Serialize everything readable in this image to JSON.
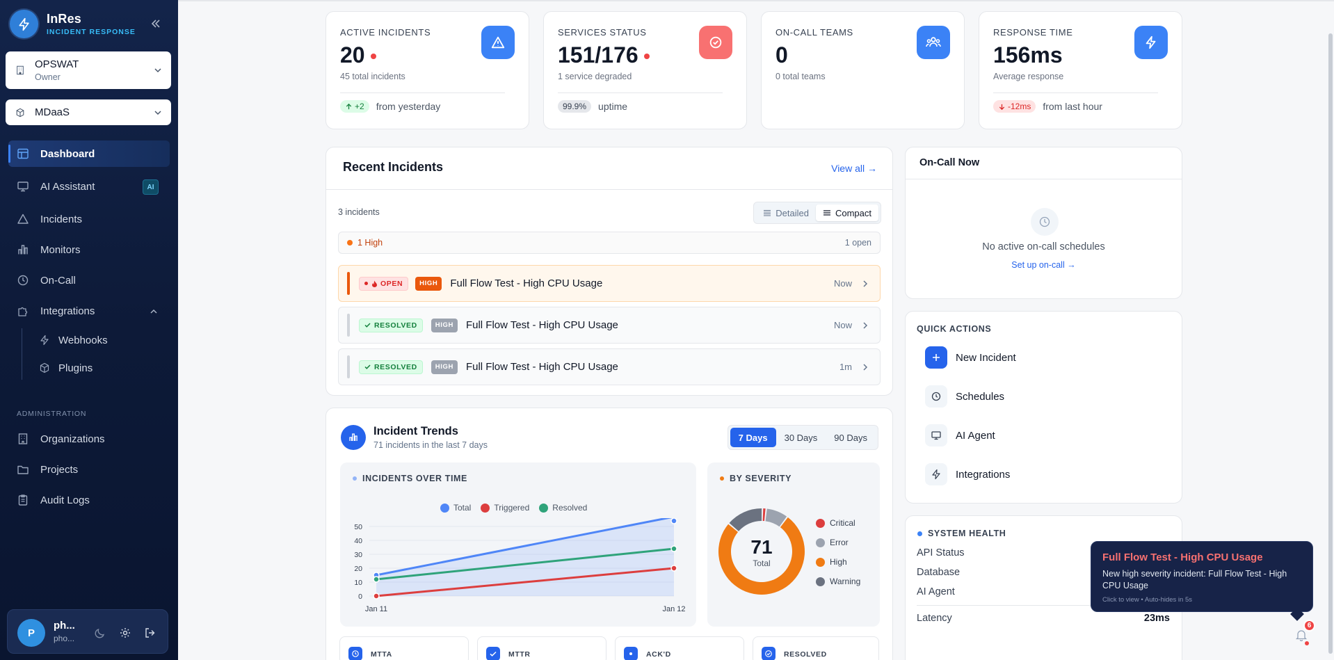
{
  "brand": {
    "name": "InRes",
    "subtitle": "INCIDENT RESPONSE"
  },
  "org_selector": {
    "name": "OPSWAT",
    "role": "Owner"
  },
  "project_selector": {
    "name": "MDaaS"
  },
  "nav": {
    "dashboard": "Dashboard",
    "ai_assistant": "AI Assistant",
    "ai_badge": "AI",
    "incidents": "Incidents",
    "monitors": "Monitors",
    "oncall": "On-Call",
    "integrations": "Integrations",
    "webhooks": "Webhooks",
    "plugins": "Plugins",
    "admin_label": "ADMINISTRATION",
    "organizations": "Organizations",
    "projects": "Projects",
    "audit_logs": "Audit Logs"
  },
  "user": {
    "initial": "P",
    "name": "ph...",
    "email": "pho..."
  },
  "stats": [
    {
      "label": "ACTIVE INCIDENTS",
      "value": "20",
      "sub": "45 total incidents",
      "badge": "+2",
      "foot": "from yesterday",
      "color": "#3b82f6"
    },
    {
      "label": "SERVICES STATUS",
      "value": "151/176",
      "sub": "1 service degraded",
      "badge": "99.9%",
      "foot": "uptime",
      "color": "#f87171"
    },
    {
      "label": "ON-CALL TEAMS",
      "value": "0",
      "sub": "0 total teams",
      "color": "#3b82f6"
    },
    {
      "label": "RESPONSE TIME",
      "value": "156ms",
      "sub": "Average response",
      "badge": "-12ms",
      "foot": "from last hour",
      "color": "#3b82f6"
    }
  ],
  "recent": {
    "title": "Recent Incidents",
    "view_all": "View all →",
    "count": "3 incidents",
    "view_detailed": "Detailed",
    "view_compact": "Compact",
    "group_label": "1 High",
    "group_count": "1 open",
    "items": [
      {
        "status": "OPEN",
        "severity": "HIGH",
        "title": "Full Flow Test - High CPU Usage",
        "time": "Now"
      },
      {
        "status": "RESOLVED",
        "severity": "HIGH",
        "title": "Full Flow Test - High CPU Usage",
        "time": "Now"
      },
      {
        "status": "RESOLVED",
        "severity": "HIGH",
        "title": "Full Flow Test - High CPU Usage",
        "time": "1m"
      }
    ]
  },
  "oncall": {
    "title": "On-Call Now",
    "empty": "No active on-call schedules",
    "setup": "Set up on-call →"
  },
  "trends": {
    "title": "Incident Trends",
    "subtitle": "71 incidents in the last 7 days",
    "tabs": [
      "7 Days",
      "30 Days",
      "90 Days"
    ],
    "over_time_label": "INCIDENTS OVER TIME",
    "severity_label": "BY SEVERITY",
    "total_value": "71",
    "total_label": "Total",
    "metrics": [
      "MTTA",
      "MTTR",
      "ACK'D",
      "RESOLVED"
    ]
  },
  "chart_data": [
    {
      "type": "area",
      "x": [
        "Jan 11",
        "Jan 12"
      ],
      "ylim": [
        0,
        50
      ],
      "yticks": [
        0,
        10,
        20,
        30,
        40,
        50
      ],
      "series": [
        {
          "name": "Total",
          "values": [
            15,
            57
          ],
          "color": "#4f86f7"
        },
        {
          "name": "Triggered",
          "values": [
            0,
            20
          ],
          "color": "#dc3e3e"
        },
        {
          "name": "Resolved",
          "values": [
            12,
            34
          ],
          "color": "#2fa37a"
        }
      ],
      "legend": "top"
    },
    {
      "type": "pie",
      "labels": [
        "Critical",
        "Error",
        "High",
        "Warning"
      ],
      "values": [
        1,
        6,
        54,
        10
      ],
      "colors": [
        "#dc3e3e",
        "#9ca3af",
        "#f07b13",
        "#6b7280"
      ],
      "legend": "right"
    }
  ],
  "quick_actions": {
    "label": "QUICK ACTIONS",
    "items": [
      "New Incident",
      "Schedules",
      "AI Agent",
      "Integrations"
    ]
  },
  "system_health": {
    "label": "SYSTEM HEALTH",
    "rows": [
      "API Status",
      "Database",
      "AI Agent"
    ],
    "latency_label": "Latency",
    "latency_value": "23ms"
  },
  "toast": {
    "title": "Full Flow Test - High CPU Usage",
    "message": "New high severity incident: Full Flow Test - High CPU Usage",
    "hint": "Click to view • Auto-hides in 5s"
  },
  "notifications": {
    "count": "6"
  }
}
